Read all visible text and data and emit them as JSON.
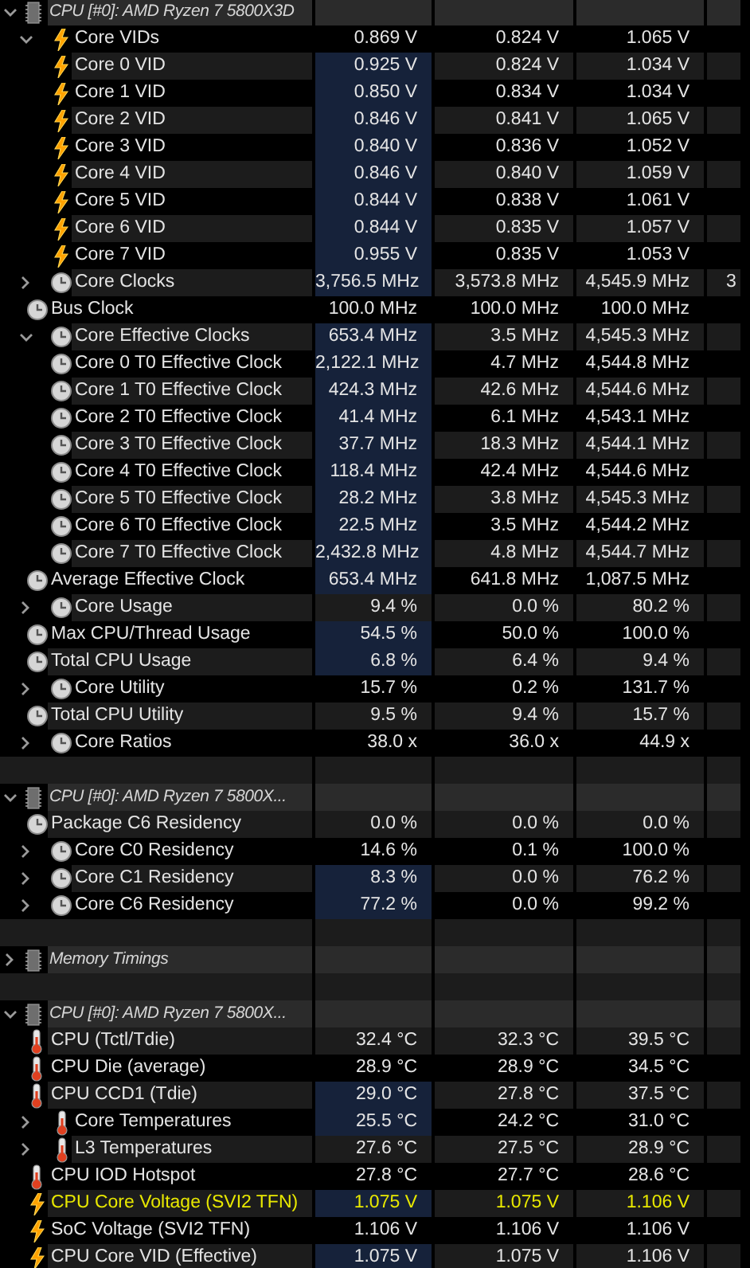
{
  "sections": [
    {
      "title": "CPU [#0]: AMD Ryzen 7 5800X3D",
      "expanded": true,
      "items": [
        {
          "label": "Core VIDs",
          "kind": "bolt",
          "current": "0.869 V",
          "min": "0.824 V",
          "max": "1.065 V",
          "expanded": true,
          "highlight": false,
          "alert": false,
          "children": [
            {
              "label": "Core 0 VID",
              "kind": "bolt",
              "current": "0.925 V",
              "min": "0.824 V",
              "max": "1.034 V",
              "highlight": true,
              "alert": false
            },
            {
              "label": "Core 1 VID",
              "kind": "bolt",
              "current": "0.850 V",
              "min": "0.834 V",
              "max": "1.034 V",
              "highlight": true,
              "alert": false
            },
            {
              "label": "Core 2 VID",
              "kind": "bolt",
              "current": "0.846 V",
              "min": "0.841 V",
              "max": "1.065 V",
              "highlight": true,
              "alert": false
            },
            {
              "label": "Core 3 VID",
              "kind": "bolt",
              "current": "0.840 V",
              "min": "0.836 V",
              "max": "1.052 V",
              "highlight": true,
              "alert": false
            },
            {
              "label": "Core 4 VID",
              "kind": "bolt",
              "current": "0.846 V",
              "min": "0.840 V",
              "max": "1.059 V",
              "highlight": true,
              "alert": false
            },
            {
              "label": "Core 5 VID",
              "kind": "bolt",
              "current": "0.844 V",
              "min": "0.838 V",
              "max": "1.061 V",
              "highlight": true,
              "alert": false
            },
            {
              "label": "Core 6 VID",
              "kind": "bolt",
              "current": "0.844 V",
              "min": "0.835 V",
              "max": "1.057 V",
              "highlight": true,
              "alert": false
            },
            {
              "label": "Core 7 VID",
              "kind": "bolt",
              "current": "0.955 V",
              "min": "0.835 V",
              "max": "1.053 V",
              "highlight": true,
              "alert": false
            }
          ]
        },
        {
          "label": "Core Clocks",
          "kind": "clock",
          "current": "3,756.5 MHz",
          "min": "3,573.8 MHz",
          "max": "4,545.9 MHz",
          "expanded": false,
          "highlight": true,
          "alert": false,
          "column_4": "3"
        },
        {
          "label": "Bus Clock",
          "kind": "clock",
          "current": "100.0 MHz",
          "min": "100.0 MHz",
          "max": "100.0 MHz",
          "highlight": false,
          "alert": false
        },
        {
          "label": "Core Effective Clocks",
          "kind": "clock",
          "current": "653.4 MHz",
          "min": "3.5 MHz",
          "max": "4,545.3 MHz",
          "expanded": true,
          "highlight": true,
          "alert": false,
          "children": [
            {
              "label": "Core 0 T0 Effective Clock",
              "kind": "clock",
              "current": "2,122.1 MHz",
              "min": "4.7 MHz",
              "max": "4,544.8 MHz",
              "highlight": true,
              "alert": false
            },
            {
              "label": "Core 1 T0 Effective Clock",
              "kind": "clock",
              "current": "424.3 MHz",
              "min": "42.6 MHz",
              "max": "4,544.6 MHz",
              "highlight": true,
              "alert": false
            },
            {
              "label": "Core 2 T0 Effective Clock",
              "kind": "clock",
              "current": "41.4 MHz",
              "min": "6.1 MHz",
              "max": "4,543.1 MHz",
              "highlight": true,
              "alert": false
            },
            {
              "label": "Core 3 T0 Effective Clock",
              "kind": "clock",
              "current": "37.7 MHz",
              "min": "18.3 MHz",
              "max": "4,544.1 MHz",
              "highlight": true,
              "alert": false
            },
            {
              "label": "Core 4 T0 Effective Clock",
              "kind": "clock",
              "current": "118.4 MHz",
              "min": "42.4 MHz",
              "max": "4,544.6 MHz",
              "highlight": true,
              "alert": false
            },
            {
              "label": "Core 5 T0 Effective Clock",
              "kind": "clock",
              "current": "28.2 MHz",
              "min": "3.8 MHz",
              "max": "4,545.3 MHz",
              "highlight": true,
              "alert": false
            },
            {
              "label": "Core 6 T0 Effective Clock",
              "kind": "clock",
              "current": "22.5 MHz",
              "min": "3.5 MHz",
              "max": "4,544.2 MHz",
              "highlight": true,
              "alert": false
            },
            {
              "label": "Core 7 T0 Effective Clock",
              "kind": "clock",
              "current": "2,432.8 MHz",
              "min": "4.8 MHz",
              "max": "4,544.7 MHz",
              "highlight": true,
              "alert": false
            }
          ]
        },
        {
          "label": "Average Effective Clock",
          "kind": "clock",
          "current": "653.4 MHz",
          "min": "641.8 MHz",
          "max": "1,087.5 MHz",
          "highlight": true,
          "alert": false
        },
        {
          "label": "Core Usage",
          "kind": "clock",
          "current": "9.4 %",
          "min": "0.0 %",
          "max": "80.2 %",
          "expanded": false,
          "highlight": false,
          "alert": false
        },
        {
          "label": "Max CPU/Thread Usage",
          "kind": "clock",
          "current": "54.5 %",
          "min": "50.0 %",
          "max": "100.0 %",
          "highlight": true,
          "alert": false
        },
        {
          "label": "Total CPU Usage",
          "kind": "clock",
          "current": "6.8 %",
          "min": "6.4 %",
          "max": "9.4 %",
          "highlight": true,
          "alert": false
        },
        {
          "label": "Core Utility",
          "kind": "clock",
          "current": "15.7 %",
          "min": "0.2 %",
          "max": "131.7 %",
          "expanded": false,
          "highlight": false,
          "alert": false
        },
        {
          "label": "Total CPU Utility",
          "kind": "clock",
          "current": "9.5 %",
          "min": "9.4 %",
          "max": "15.7 %",
          "highlight": false,
          "alert": false
        },
        {
          "label": "Core Ratios",
          "kind": "clock",
          "current": "38.0 x",
          "min": "36.0 x",
          "max": "44.9 x",
          "expanded": false,
          "highlight": false,
          "alert": false
        }
      ]
    },
    {
      "title": "CPU [#0]: AMD Ryzen 7 5800X...",
      "expanded": true,
      "items": [
        {
          "label": "Package C6 Residency",
          "kind": "clock",
          "current": "0.0 %",
          "min": "0.0 %",
          "max": "0.0 %",
          "highlight": false,
          "alert": false
        },
        {
          "label": "Core C0 Residency",
          "kind": "clock",
          "current": "14.6 %",
          "min": "0.1 %",
          "max": "100.0 %",
          "expanded": false,
          "highlight": false,
          "alert": false
        },
        {
          "label": "Core C1 Residency",
          "kind": "clock",
          "current": "8.3 %",
          "min": "0.0 %",
          "max": "76.2 %",
          "expanded": false,
          "highlight": true,
          "alert": false
        },
        {
          "label": "Core C6 Residency",
          "kind": "clock",
          "current": "77.2 %",
          "min": "0.0 %",
          "max": "99.2 %",
          "expanded": false,
          "highlight": true,
          "alert": false
        }
      ]
    },
    {
      "title": "Memory Timings",
      "expanded": false
    },
    {
      "title": "CPU [#0]: AMD Ryzen 7 5800X...",
      "expanded": true,
      "items": [
        {
          "label": "CPU (Tctl/Tdie)",
          "kind": "thermometer",
          "current": "32.4 °C",
          "min": "32.3 °C",
          "max": "39.5 °C",
          "highlight": false,
          "alert": false
        },
        {
          "label": "CPU Die (average)",
          "kind": "thermometer",
          "current": "28.9 °C",
          "min": "28.9 °C",
          "max": "34.5 °C",
          "highlight": false,
          "alert": false
        },
        {
          "label": "CPU CCD1 (Tdie)",
          "kind": "thermometer",
          "current": "29.0 °C",
          "min": "27.8 °C",
          "max": "37.5 °C",
          "highlight": true,
          "alert": false
        },
        {
          "label": "Core Temperatures",
          "kind": "thermometer",
          "current": "25.5 °C",
          "min": "24.2 °C",
          "max": "31.0 °C",
          "expanded": false,
          "highlight": true,
          "alert": false
        },
        {
          "label": "L3 Temperatures",
          "kind": "thermometer",
          "current": "27.6 °C",
          "min": "27.5 °C",
          "max": "28.9 °C",
          "expanded": false,
          "highlight": false,
          "alert": false
        },
        {
          "label": "CPU IOD Hotspot",
          "kind": "thermometer",
          "current": "27.8 °C",
          "min": "27.7 °C",
          "max": "28.6 °C",
          "highlight": false,
          "alert": false
        },
        {
          "label": "CPU Core Voltage (SVI2 TFN)",
          "kind": "bolt",
          "current": "1.075 V",
          "min": "1.075 V",
          "max": "1.106 V",
          "highlight": true,
          "alert": true
        },
        {
          "label": "SoC Voltage (SVI2 TFN)",
          "kind": "bolt",
          "current": "1.106 V",
          "min": "1.106 V",
          "max": "1.106 V",
          "highlight": false,
          "alert": false
        },
        {
          "label": "CPU Core VID (Effective)",
          "kind": "bolt",
          "current": "1.075 V",
          "min": "1.075 V",
          "max": "1.106 V",
          "highlight": true,
          "alert": false
        }
      ]
    }
  ]
}
